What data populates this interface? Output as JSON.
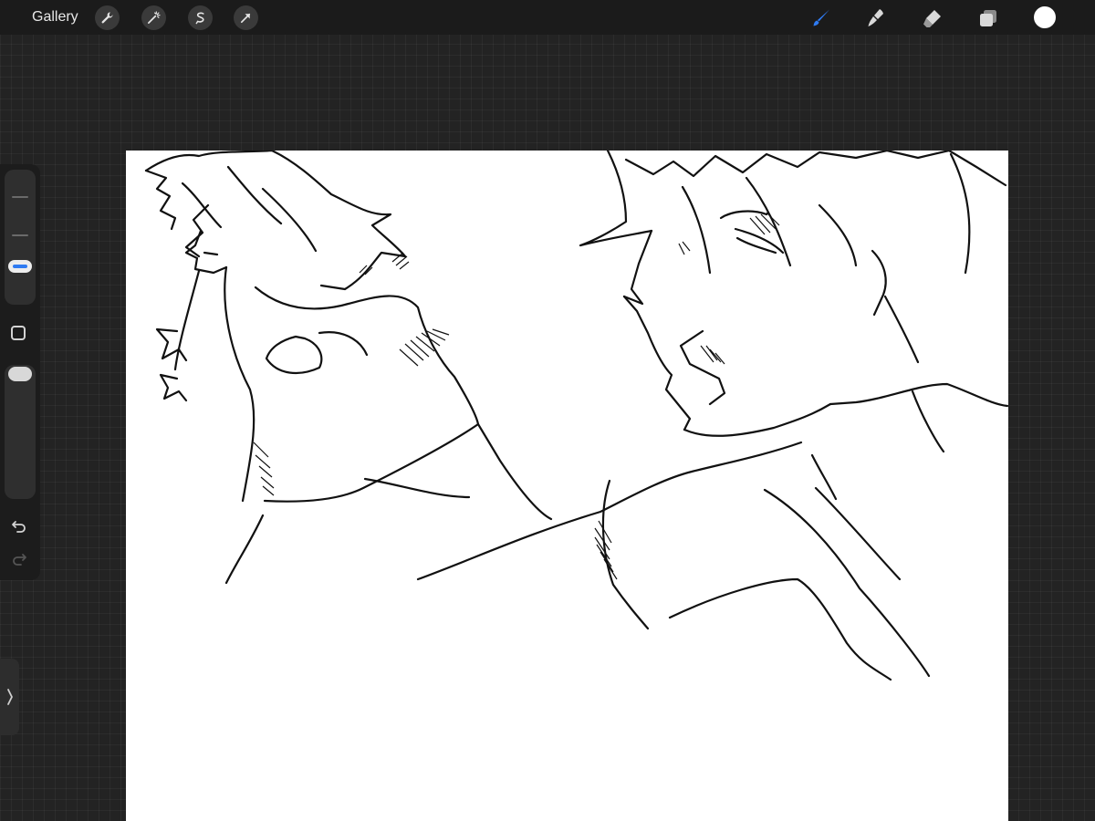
{
  "topbar": {
    "gallery_label": "Gallery",
    "left_tools": [
      "wrench-icon",
      "magic-wand-icon",
      "selection-icon",
      "transform-arrow-icon"
    ],
    "right_tools": [
      "brush-icon",
      "smudge-icon",
      "eraser-icon",
      "layers-icon"
    ],
    "active_tool": "brush-icon",
    "active_color": "#2f7bf2",
    "current_color": "#ffffff"
  },
  "sidebar": {
    "brush_size_level": 0.5,
    "opacity_level": 1.0,
    "icons": [
      "modify-square-icon",
      "undo-icon",
      "redo-icon"
    ]
  },
  "canvas": {
    "background": "#ffffff",
    "content": "line-art-sketch"
  }
}
